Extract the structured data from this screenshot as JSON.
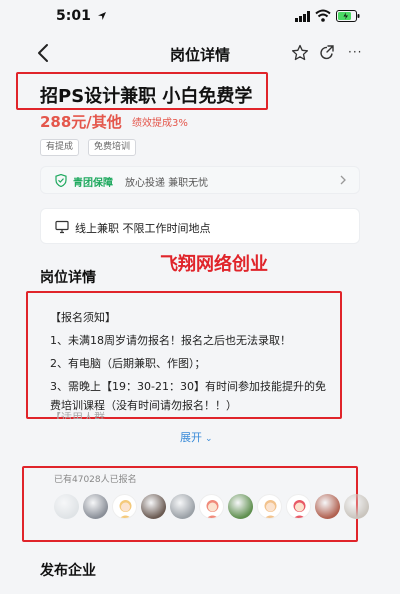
{
  "status_bar": {
    "time": "5:01"
  },
  "nav": {
    "title": "岗位详情",
    "more": "···"
  },
  "job": {
    "title": "招PS设计兼职 小白免费学",
    "salary": "288元/其他",
    "bonus": "绩效提成3%",
    "tags": [
      "有提成",
      "免费培训"
    ]
  },
  "guarantee": {
    "name": "青团保障",
    "desc": "放心投递 兼职无忧"
  },
  "work_type": {
    "text": "线上兼职 不限工作时间地点"
  },
  "watermark": "飞翔网络创业",
  "section": {
    "title": "岗位详情"
  },
  "description": {
    "lines": [
      "【报名须知】",
      "1、未满18周岁请勿报名！报名之后也无法录取！",
      "2、有电脑（后期兼职、作图）；",
      "3、需晚上【19：30-21：30】有时间参加技能提升的免",
      "费培训课程（没有时间请勿报名！！）",
      "【适用人群"
    ],
    "expand_label": "展开"
  },
  "applicants": {
    "count_text": "已有47028人已报名",
    "avatars": [
      {
        "kind": "photo",
        "color": "#dfe3e6"
      },
      {
        "kind": "photo",
        "color": "#8a8f98"
      },
      {
        "kind": "cartoon",
        "color": "#f4c97a"
      },
      {
        "kind": "photo",
        "color": "#6a5a52"
      },
      {
        "kind": "photo",
        "color": "#9aa0a6"
      },
      {
        "kind": "cartoon",
        "color": "#f08a7a"
      },
      {
        "kind": "photo",
        "color": "#5e8f4e"
      },
      {
        "kind": "cartoon",
        "color": "#f2c28c"
      },
      {
        "kind": "cartoon",
        "color": "#e85a66"
      },
      {
        "kind": "photo",
        "color": "#b0604f"
      },
      {
        "kind": "photo",
        "color": "#c9c4bd"
      }
    ]
  },
  "footer": {
    "title": "发布企业"
  },
  "colors": {
    "accent_red": "#e0242a",
    "salary": "#e4564b",
    "green": "#1fa95f",
    "link": "#3b8cd9"
  }
}
